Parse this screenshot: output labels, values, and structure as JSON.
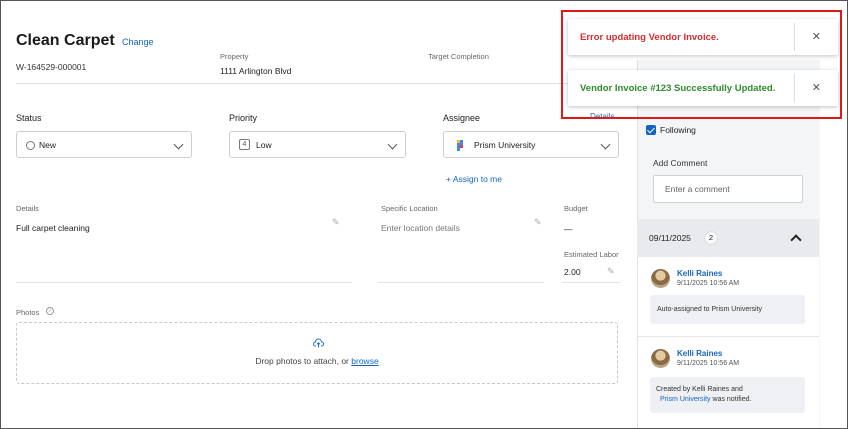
{
  "header": {
    "title": "Clean Carpet",
    "change_label": "Change",
    "work_order_id": "W-164529-000001",
    "property_label": "Property",
    "property_value": "1111 Arlington Blvd",
    "target_label": "Target Completion",
    "details_link": "Details"
  },
  "fields": {
    "status_label": "Status",
    "status_value": "New",
    "priority_label": "Priority",
    "priority_badge": "4",
    "priority_value": "Low",
    "assignee_label": "Assignee",
    "assignee_value": "Prism University",
    "assign_to_me": "+ Assign to me"
  },
  "details": {
    "details_label": "Details",
    "details_value": "Full carpet cleaning",
    "location_label": "Specific Location",
    "location_placeholder": "Enter location details",
    "budget_label": "Budget",
    "budget_value": "—",
    "labor_label": "Estimated Labor",
    "labor_value": "2.00"
  },
  "photos": {
    "label": "Photos",
    "drop_text": "Drop photos to attach, or",
    "browse": "browse"
  },
  "sidebar": {
    "following_label": "Following",
    "add_comment_label": "Add Comment",
    "comment_placeholder": "Enter a comment",
    "date_group": "09/11/2025",
    "date_count": "2",
    "entries": [
      {
        "name": "Kelli Raines",
        "time": "9/11/2025 10:56 AM",
        "text": "Auto-assigned to Prism University"
      },
      {
        "name": "Kelli Raines",
        "time": "9/11/2025 10:56 AM",
        "text_pre": "Created by Kelli Raines and",
        "text_link": "Prism University",
        "text_post": "was notified."
      }
    ]
  },
  "toasts": [
    {
      "message": "Error updating Vendor Invoice.",
      "color": "#d32f2f"
    },
    {
      "message": "Vendor Invoice #123 Successfully Updated.",
      "color": "#2e8b2e"
    }
  ],
  "colors": {
    "accent": "#1565c0",
    "highlight_border": "#e01818"
  }
}
